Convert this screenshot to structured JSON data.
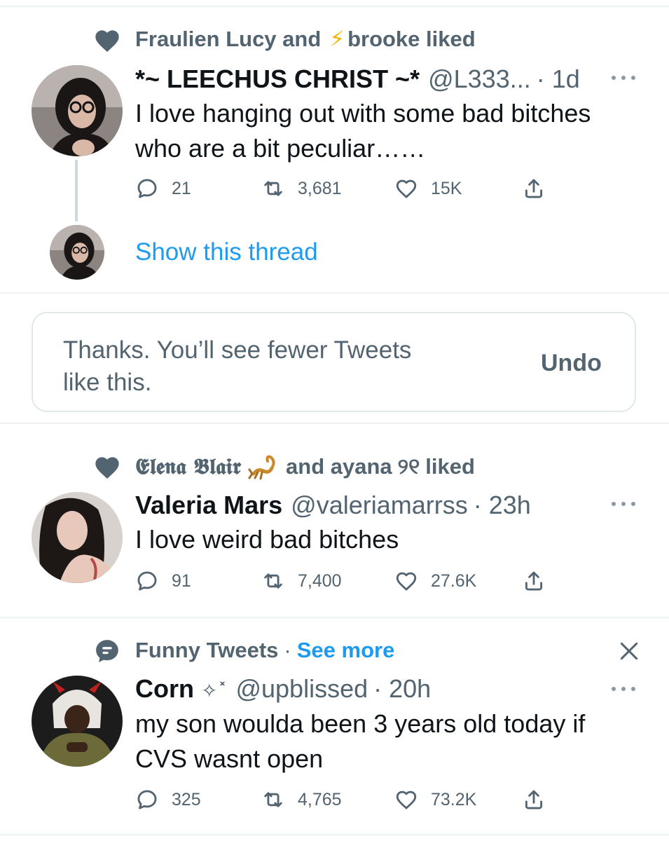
{
  "tweet1": {
    "social": "Fraulien Lucy and",
    "social_emoji": "⚡",
    "social_after": "brooke liked",
    "display_name": "*~ LEECHUS CHRIST ~*",
    "handle": "@L333...",
    "time": "· 1d",
    "text_line1": "I love hanging out with some bad bitches",
    "text_line2": "who are a bit peculiar……",
    "replies": "21",
    "retweets": "3,681",
    "likes": "15K",
    "show_thread": "Show this thread"
  },
  "feedback": {
    "message_line1": "Thanks. You’ll see fewer Tweets",
    "message_line2": "like this.",
    "undo": "Undo"
  },
  "tweet2": {
    "social_name": "𝕰𝖑𝖊𝖓𝖆 𝕭𝖑𝖆𝖎𝖗",
    "social_after": "and ayana",
    "social_glyph": "୨୧",
    "social_end": "liked",
    "display_name": "Valeria Mars",
    "handle": "@valeriamarrss",
    "time": "· 23h",
    "text": "I love weird bad bitches",
    "replies": "91",
    "retweets": "7,400",
    "likes": "27.6K"
  },
  "tweet3": {
    "topic": "Funny Tweets",
    "dot": "·",
    "see_more": "See more",
    "display_name": "Corn",
    "name_glyphs": "✧˟",
    "handle": "@upblissed",
    "time": "· 20h",
    "text_line1": "my son woulda been 3 years old today if",
    "text_line2": "CVS wasnt open",
    "replies": "325",
    "retweets": "4,765",
    "likes": "73.2K"
  },
  "colors": {
    "accent": "#1d9bf0",
    "secondary_text": "#536471",
    "primary_text": "#0f1419",
    "divider": "#eff3f4"
  }
}
